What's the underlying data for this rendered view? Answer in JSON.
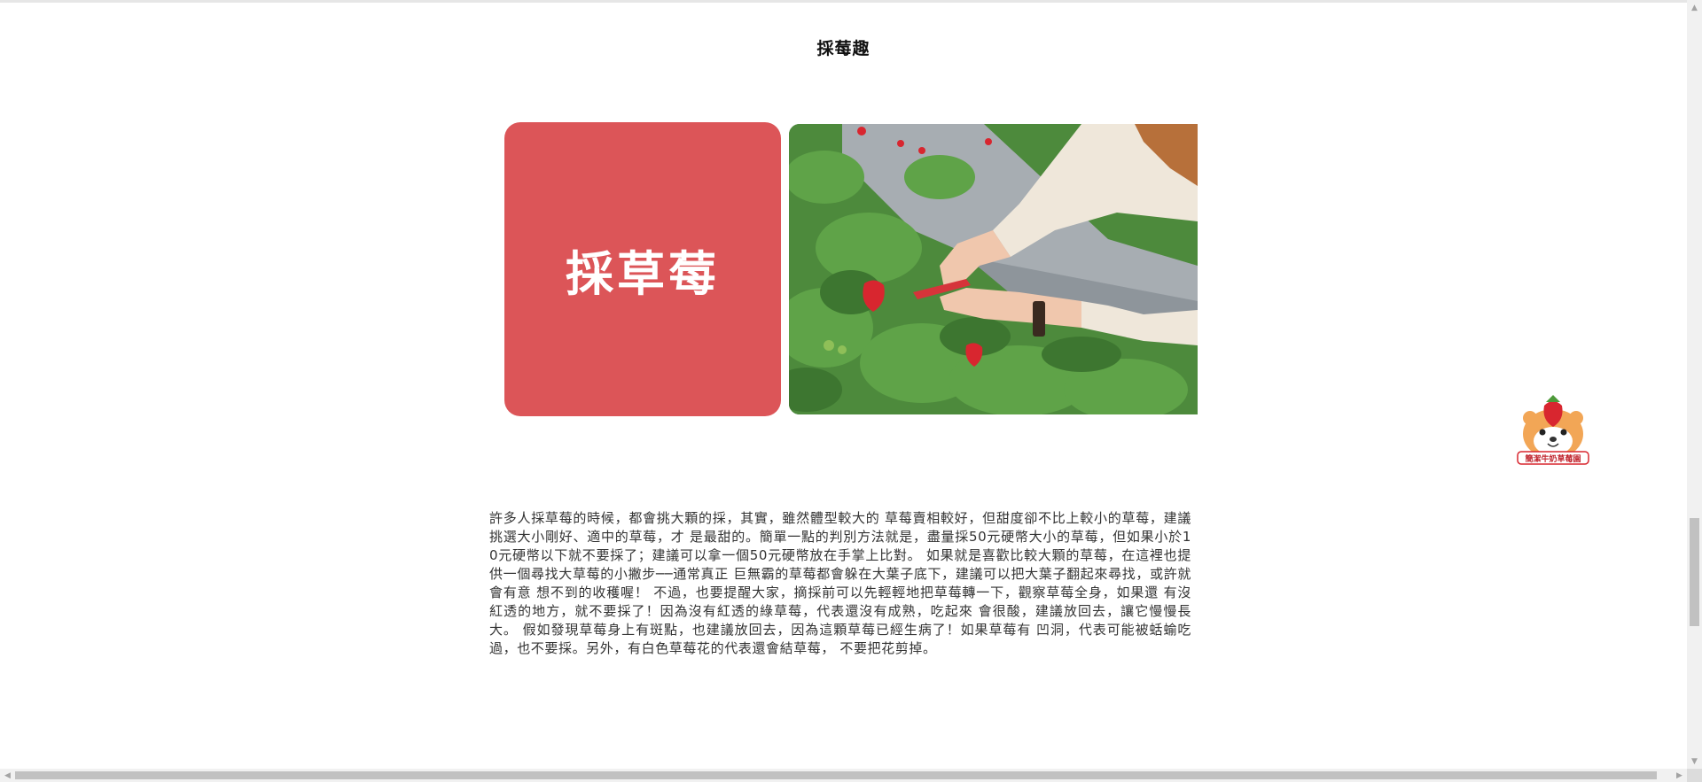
{
  "section": {
    "title": "採莓趣"
  },
  "banner": {
    "text": "採草莓"
  },
  "photo": {
    "alt": "採草莓照片"
  },
  "article": {
    "text": "許多人採草莓的時候，都會挑大顆的採，其實，雖然體型較大的 草莓賣相較好，但甜度卻不比上較小的草莓，建議挑選大小剛好、適中的草莓，才 是最甜的。簡單一點的判別方法就是，盡量採50元硬幣大小的草莓，但如果小於1 0元硬幣以下就不要採了；建議可以拿一個50元硬幣放在手掌上比對。 如果就是喜歡比較大顆的草莓，在這裡也提供一個尋找大草莓的小撇步──通常真正 巨無霸的草莓都會躲在大葉子底下，建議可以把大葉子翻起來尋找，或許就會有意 想不到的收穫喔！ 不過，也要提醒大家，摘採前可以先輕輕地把草莓轉一下，觀察草莓全身，如果還 有沒紅透的地方，就不要採了！因為沒有紅透的綠草莓，代表還沒有成熟，吃起來 會很酸，建議放回去，讓它慢慢長大。 假如發現草莓身上有斑點，也建議放回去，因為這顆草莓已經生病了！如果草莓有 凹洞，代表可能被蛞蝓吃過，也不要採。另外，有白色草莓花的代表還會結草莓， 不要把花剪掉。"
  },
  "mascot": {
    "label": "簡潔牛奶草莓園"
  },
  "colors": {
    "banner": "#dc5558",
    "scrollbar_track": "#f1f1f1",
    "scrollbar_thumb": "#c1c1c1"
  }
}
